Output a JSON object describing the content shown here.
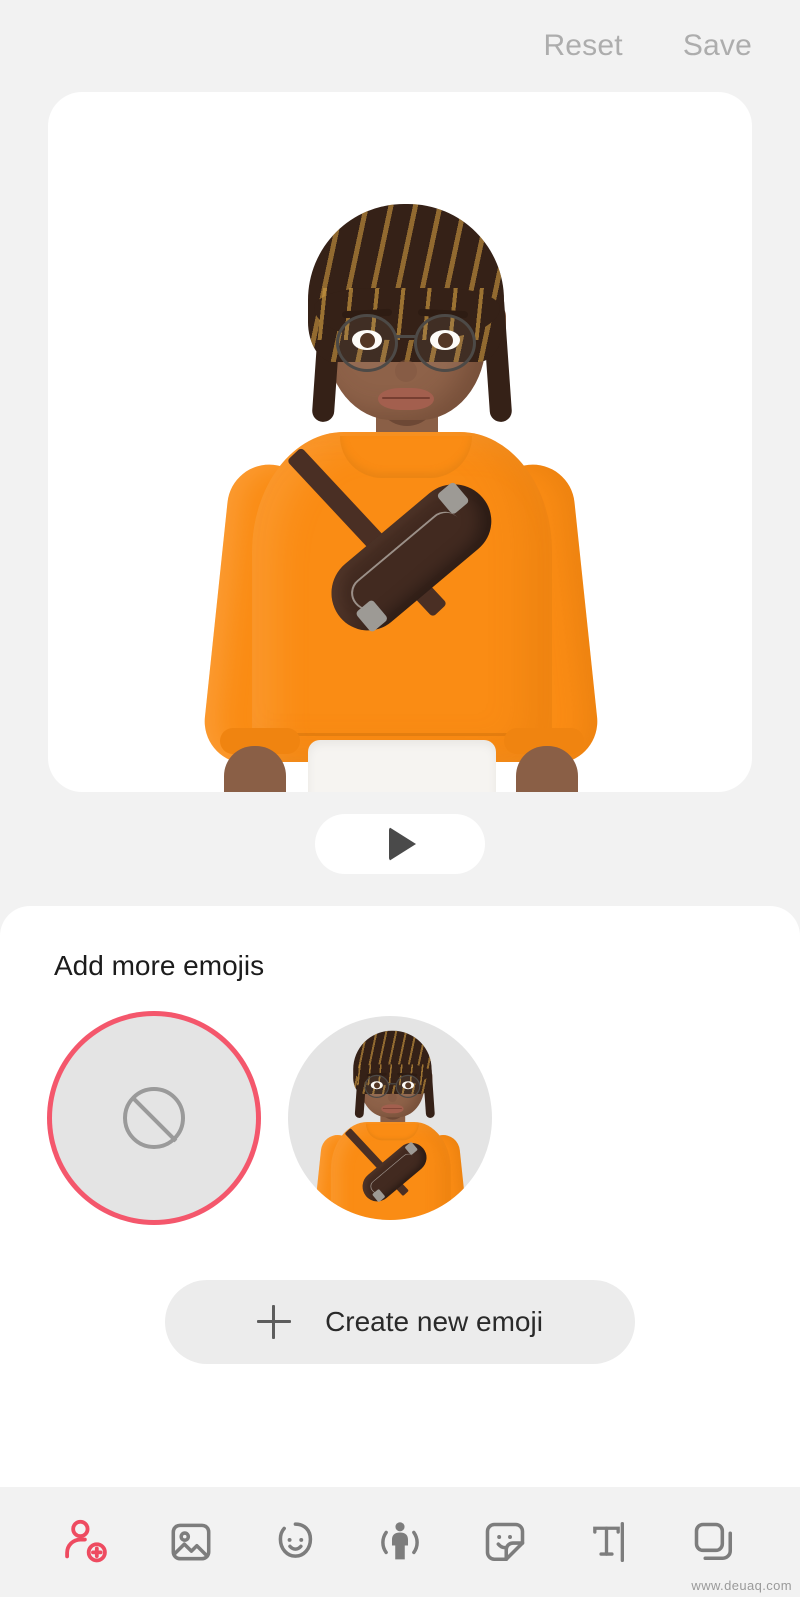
{
  "topbar": {
    "reset_label": "Reset",
    "save_label": "Save"
  },
  "preview": {
    "play_icon": "play-icon",
    "avatar": {
      "sweater_color": "#fa8c14",
      "skin_color": "#8e6249",
      "hair_color": "#352117",
      "hair_highlight_color": "#c6943e",
      "bag_color": "#422a20",
      "pants_color": "#f6f4f1",
      "glasses_color": "#4d4a47"
    }
  },
  "sheet": {
    "title": "Add more emojis",
    "emoji_options": [
      {
        "id": "none",
        "icon": "no-emoji-icon",
        "selected": true
      },
      {
        "id": "avatar-1",
        "icon": "avatar-thumbnail",
        "selected": false
      }
    ],
    "create_button": {
      "icon": "plus-icon",
      "label": "Create new emoji"
    }
  },
  "toolbar": {
    "active_color": "#ee4b60",
    "inactive_color": "#7d7d7d",
    "items": [
      {
        "id": "ar-emoji",
        "icon": "add-person-icon",
        "active": true
      },
      {
        "id": "gallery",
        "icon": "image-icon",
        "active": false
      },
      {
        "id": "face",
        "icon": "smiley-face-icon",
        "active": false
      },
      {
        "id": "motion",
        "icon": "person-motion-icon",
        "active": false
      },
      {
        "id": "sticker",
        "icon": "sticker-icon",
        "active": false
      },
      {
        "id": "text",
        "icon": "text-icon",
        "active": false
      },
      {
        "id": "frames",
        "icon": "layers-icon",
        "active": false
      }
    ]
  },
  "watermark": {
    "text": "www.deuaq.com"
  }
}
